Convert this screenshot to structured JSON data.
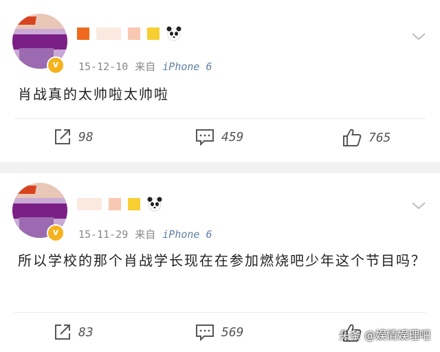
{
  "posts": [
    {
      "date": "15-12-10",
      "source_prefix": "来自",
      "source": "iPhone 6",
      "text": "肖战真的太帅啦太帅啦",
      "share_count": "98",
      "comment_count": "459",
      "like_count": "765"
    },
    {
      "date": "15-11-29",
      "source_prefix": "来自",
      "source": "iPhone 6",
      "text": "所以学校的那个肖战学长现在在参加燃烧吧少年这个节目吗？",
      "share_count": "83",
      "comment_count": "569",
      "like_count": ""
    }
  ],
  "verified_badge": "v",
  "watermark": "头条 @娱情娱理吧",
  "icons": [
    "share-icon",
    "comment-icon",
    "like-icon",
    "chevron-down-icon",
    "panda-icon"
  ],
  "colors": {
    "background": "#f2f2f2",
    "card": "#ffffff",
    "source_link": "#5d7fa6",
    "badge": "#f5b21c"
  }
}
